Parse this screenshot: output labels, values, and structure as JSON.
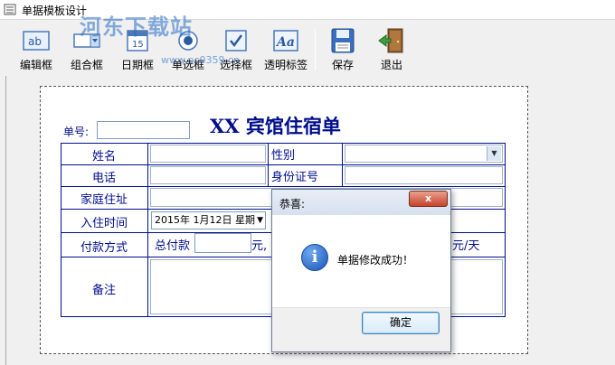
{
  "window": {
    "title": "单据模板设计"
  },
  "watermark": {
    "text": "河东下载站",
    "url": "www.pc0359.cn"
  },
  "toolbar": {
    "items": [
      {
        "label": "编辑框"
      },
      {
        "label": "组合框"
      },
      {
        "label": "日期框"
      },
      {
        "label": "单选框"
      },
      {
        "label": "选择框"
      },
      {
        "label": "透明标签"
      },
      {
        "label": "保存"
      },
      {
        "label": "退出"
      }
    ]
  },
  "form": {
    "title": "XX 宾馆住宿单",
    "bill_no_label": "单号:",
    "rows": {
      "name_label": "姓名",
      "gender_label": "性别",
      "phone_label": "电话",
      "id_label": "身份证号",
      "address_label": "家庭住址",
      "checkin_label": "入住时间",
      "payment_label": "付款方式",
      "remark_label": "备注"
    },
    "checkin_value": "2015年  1月12日  星期",
    "total_label": "总付款",
    "yuan_suffix": "元,",
    "per_day_suffix": "元/天"
  },
  "dialog": {
    "title": "恭喜:",
    "message": "单据修改成功！",
    "ok_label": "确定",
    "close_symbol": "x"
  },
  "colors": {
    "form_blue": "#000e8c",
    "canvas_bg": "#ffffff",
    "window_bg": "#f0f0f0"
  }
}
